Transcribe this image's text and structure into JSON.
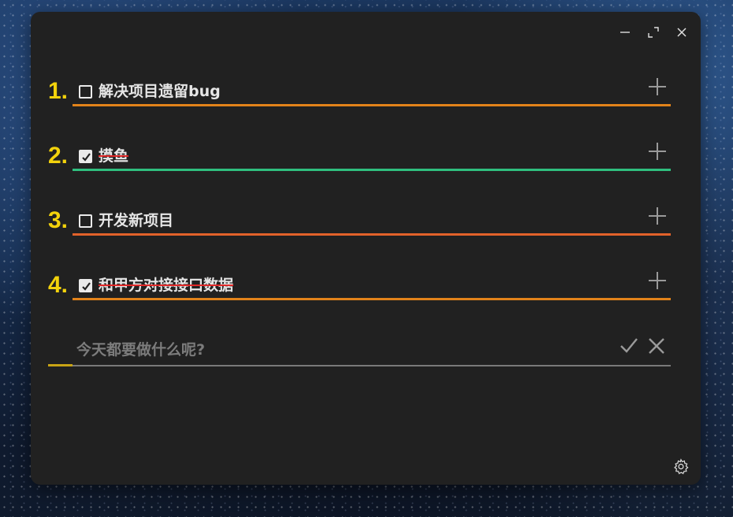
{
  "todos": [
    {
      "number": "1.",
      "text": "解决项目遗留bug",
      "checked": false,
      "color": "#e2831a"
    },
    {
      "number": "2.",
      "text": "摸鱼",
      "checked": true,
      "color": "#2fbf7f"
    },
    {
      "number": "3.",
      "text": "开发新项目",
      "checked": false,
      "color": "#e2622a"
    },
    {
      "number": "4.",
      "text": "和甲方对接接口数据",
      "checked": true,
      "color": "#e2831a"
    }
  ],
  "new_todo": {
    "placeholder": "今天都要做什么呢?",
    "value": ""
  },
  "icons": {
    "minimize": "minimize-icon",
    "maximize": "maximize-icon",
    "close": "close-icon",
    "add": "plus-icon",
    "confirm": "check-icon",
    "cancel": "x-icon",
    "settings": "gear-icon"
  },
  "colors": {
    "number": "#f2d20c",
    "strike": "#e02828",
    "input_accent": "#c8a415",
    "window_bg": "#212121"
  }
}
